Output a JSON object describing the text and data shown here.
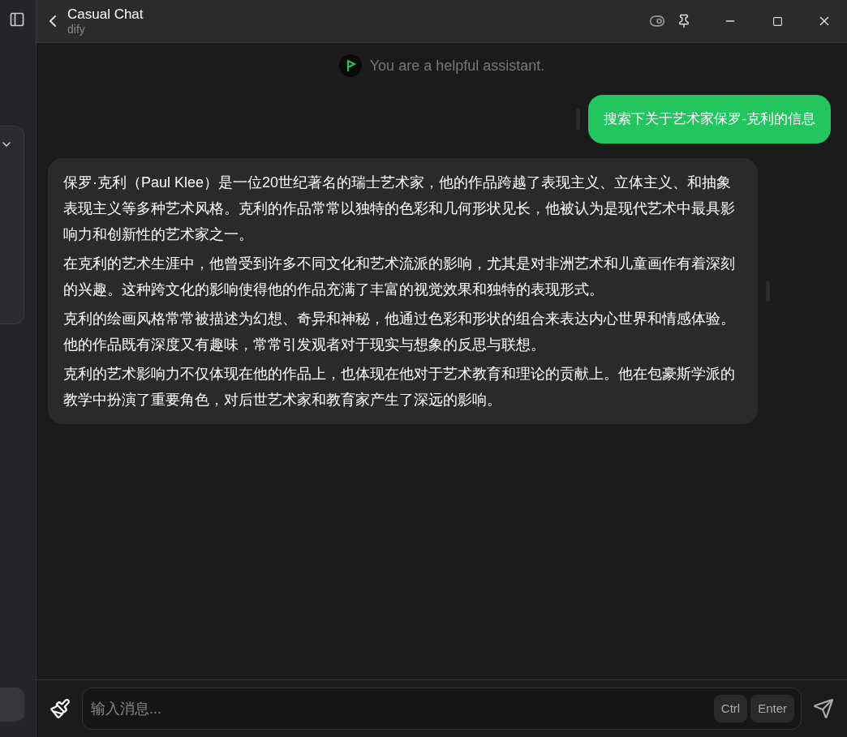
{
  "window": {
    "title": "Casual Chat",
    "subtitle": "dify"
  },
  "system_prompt": "You are a helpful assistant.",
  "messages": [
    {
      "kind": "user",
      "paragraphs": [
        "搜索下关于艺术家保罗-克利的信息"
      ]
    },
    {
      "kind": "assistant",
      "paragraphs": [
        "保罗·克利（Paul Klee）是一位20世纪著名的瑞士艺术家，他的作品跨越了表现主义、立体主义、和抽象表现主义等多种艺术风格。克利的作品常常以独特的色彩和几何形状见长，他被认为是现代艺术中最具影响力和创新性的艺术家之一。",
        "在克利的艺术生涯中，他曾受到许多不同文化和艺术流派的影响，尤其是对非洲艺术和儿童画作有着深刻的兴趣。这种跨文化的影响使得他的作品充满了丰富的视觉效果和独特的表现形式。",
        "克利的绘画风格常常被描述为幻想、奇异和神秘，他通过色彩和形状的组合来表达内心世界和情感体验。他的作品既有深度又有趣味，常常引发观者对于现实与想象的反思与联想。",
        "克利的艺术影响力不仅体现在他的作品上，也体现在他对于艺术教育和理论的贡献上。他在包豪斯学派的教学中扮演了重要角色，对后世艺术家和教育家产生了深远的影响。"
      ]
    }
  ],
  "input": {
    "placeholder": "输入消息...",
    "keys": [
      "Ctrl",
      "Enter"
    ]
  }
}
